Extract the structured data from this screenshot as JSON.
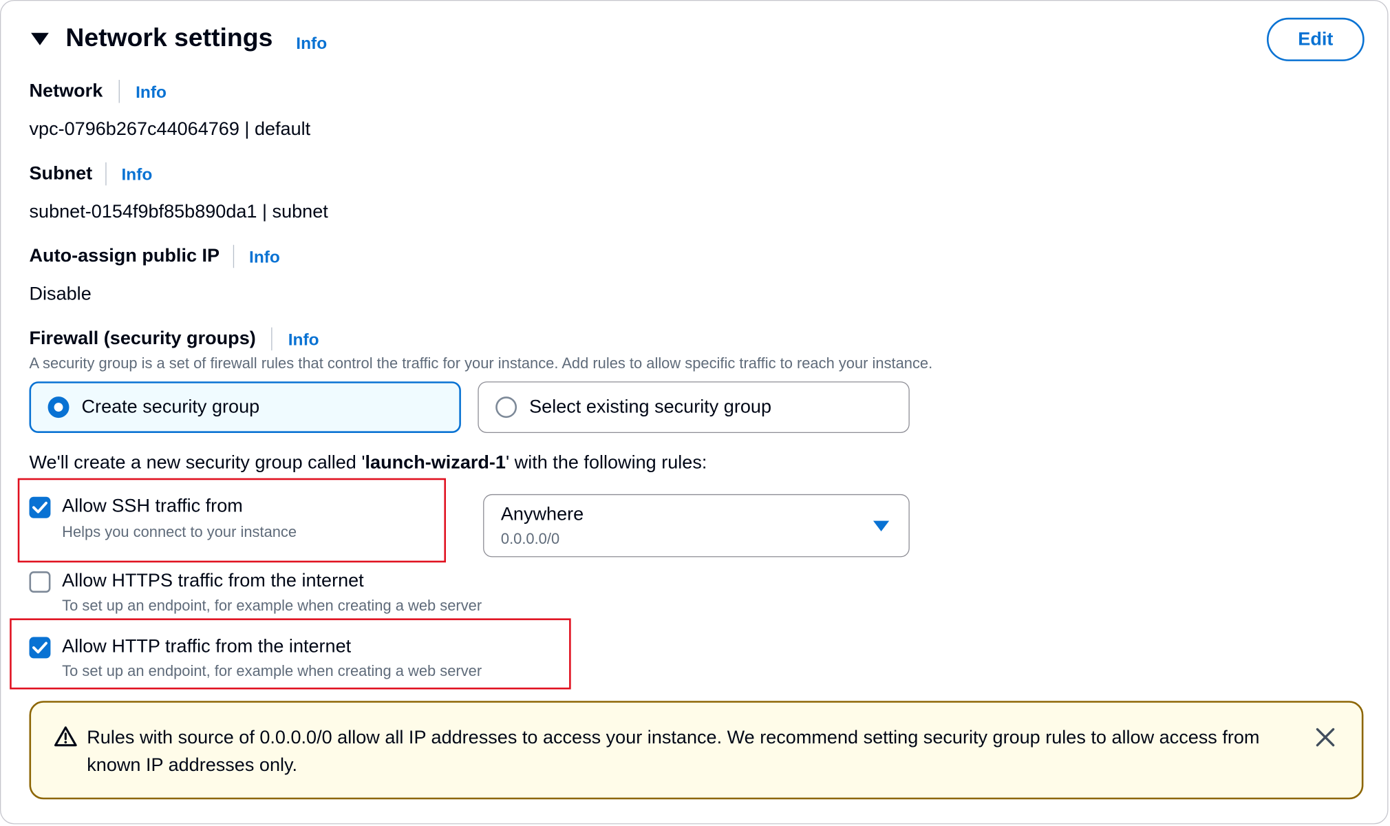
{
  "header": {
    "title": "Network settings",
    "info": "Info",
    "edit_label": "Edit"
  },
  "network": {
    "label": "Network",
    "info": "Info",
    "value": "vpc-0796b267c44064769 | default"
  },
  "subnet": {
    "label": "Subnet",
    "info": "Info",
    "value": "subnet-0154f9bf85b890da1 | subnet"
  },
  "public_ip": {
    "label": "Auto-assign public IP",
    "info": "Info",
    "value": "Disable"
  },
  "firewall": {
    "label": "Firewall (security groups)",
    "info": "Info",
    "description": "A security group is a set of firewall rules that control the traffic for your instance. Add rules to allow specific traffic to reach your instance.",
    "options": [
      {
        "label": "Create security group",
        "selected": true
      },
      {
        "label": "Select existing security group",
        "selected": false
      }
    ]
  },
  "rules_intro": {
    "prefix": "We'll create a new security group called '",
    "name": "launch-wizard-1",
    "suffix": "' with the following rules:"
  },
  "rules": [
    {
      "label": "Allow SSH traffic from",
      "description": "Helps you connect to your instance",
      "checked": true
    },
    {
      "label": "Allow HTTPS traffic from the internet",
      "description": "To set up an endpoint, for example when creating a web server",
      "checked": false
    },
    {
      "label": "Allow HTTP traffic from the internet",
      "description": "To set up an endpoint, for example when creating a web server",
      "checked": true
    }
  ],
  "ssh_source": {
    "value": "Anywhere",
    "sub": "0.0.0.0/0"
  },
  "alert": {
    "text": "Rules with source of 0.0.0.0/0 allow all IP addresses to access your instance. We recommend setting security group rules to allow access from known IP addresses only.",
    "icon": "warning-icon"
  },
  "colors": {
    "accent": "#0972d3",
    "highlight": "#e0101f",
    "warning_border": "#8d6605",
    "warning_bg": "#fffce9"
  }
}
